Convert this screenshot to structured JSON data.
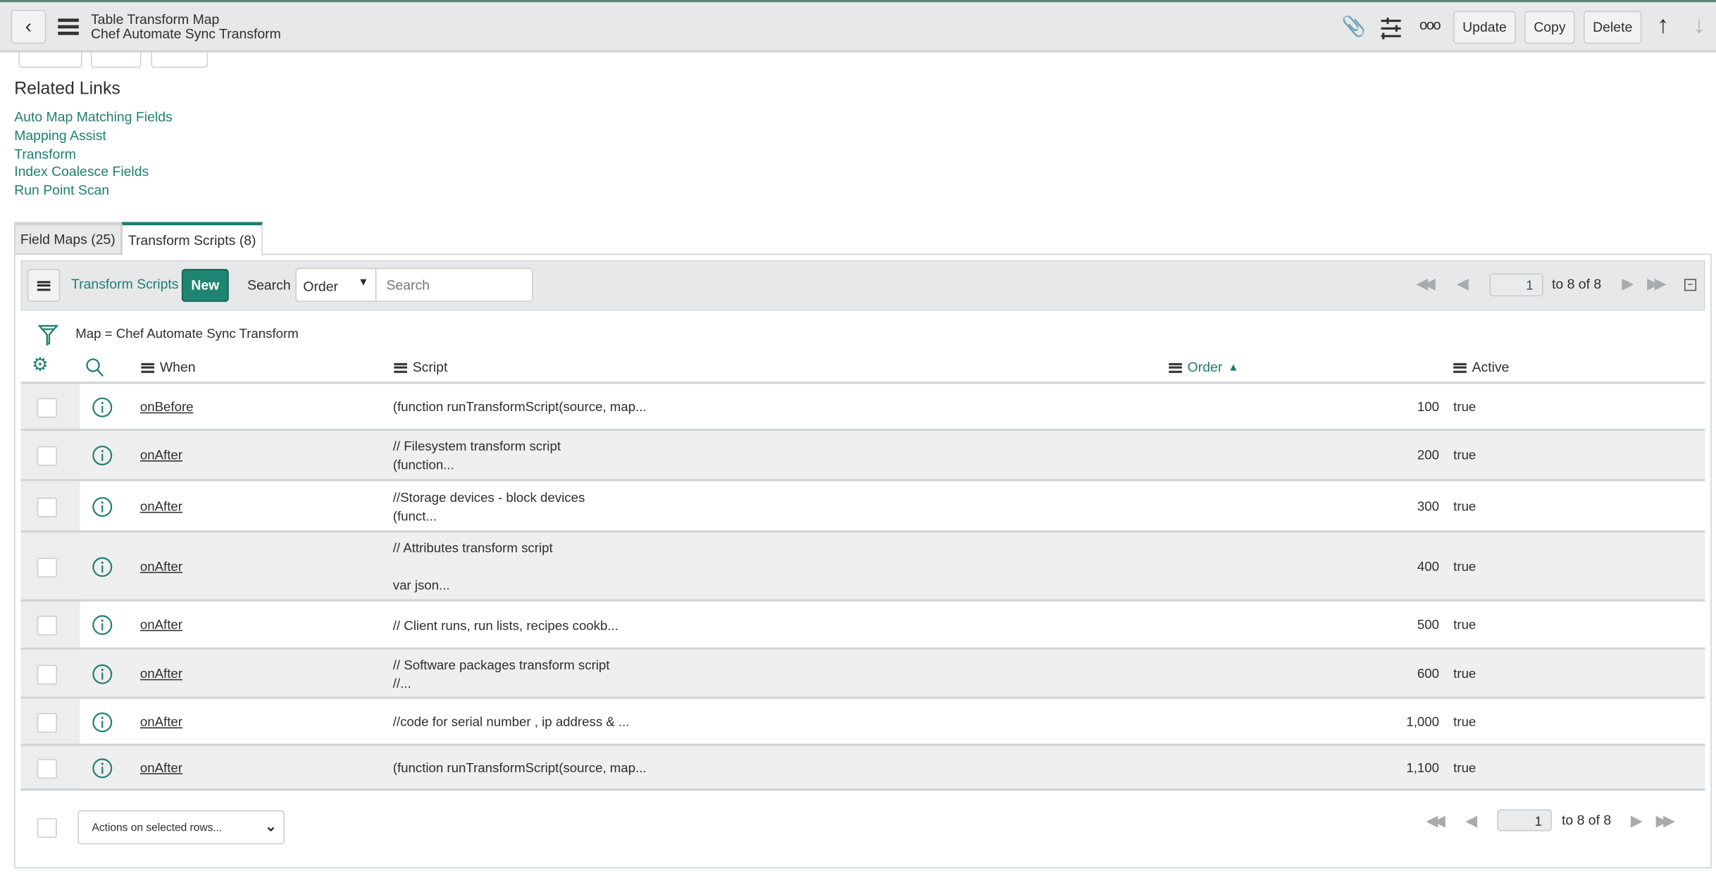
{
  "header": {
    "title": "Table Transform Map",
    "subtitle": "Chef Automate Sync Transform",
    "update": "Update",
    "copy": "Copy",
    "delete": "Delete"
  },
  "related_links": {
    "heading": "Related Links",
    "items": [
      "Auto Map Matching Fields",
      "Mapping Assist",
      "Transform",
      "Index Coalesce Fields",
      "Run Point Scan"
    ]
  },
  "tabs": [
    {
      "label": "Field Maps (25)",
      "active": false
    },
    {
      "label": "Transform Scripts (8)",
      "active": true
    }
  ],
  "list": {
    "title": "Transform Scripts",
    "new_label": "New",
    "search_label": "Search",
    "search_field": "Order",
    "search_placeholder": "Search",
    "page": "1",
    "range": "to 8 of 8",
    "filter": "Map = Chef Automate Sync Transform",
    "columns": {
      "when": "When",
      "script": "Script",
      "order": "Order",
      "active": "Active"
    },
    "rows": [
      {
        "when": "onBefore",
        "script": [
          "(function runTransformScript(source, map..."
        ],
        "order": "100",
        "active": "true"
      },
      {
        "when": "onAfter",
        "script": [
          "// Filesystem transform script",
          "(function..."
        ],
        "order": "200",
        "active": "true"
      },
      {
        "when": "onAfter",
        "script": [
          "//Storage devices - block devices",
          "(funct..."
        ],
        "order": "300",
        "active": "true"
      },
      {
        "when": "onAfter",
        "script": [
          "// Attributes transform script",
          "",
          "var json..."
        ],
        "order": "400",
        "active": "true"
      },
      {
        "when": "onAfter",
        "script": [
          "// Client runs, run lists, recipes cookb..."
        ],
        "order": "500",
        "active": "true"
      },
      {
        "when": "onAfter",
        "script": [
          "// Software packages transform script",
          "//..."
        ],
        "order": "600",
        "active": "true"
      },
      {
        "when": "onAfter",
        "script": [
          "//code for serial number , ip address & ..."
        ],
        "order": "1,000",
        "active": "true"
      },
      {
        "when": "onAfter",
        "script": [
          "(function runTransformScript(source, map..."
        ],
        "order": "1,100",
        "active": "true"
      }
    ],
    "actions_placeholder": "Actions on selected rows..."
  },
  "colors": {
    "accent": "#1f7f6f",
    "header_bg": "#e6e8ea"
  }
}
